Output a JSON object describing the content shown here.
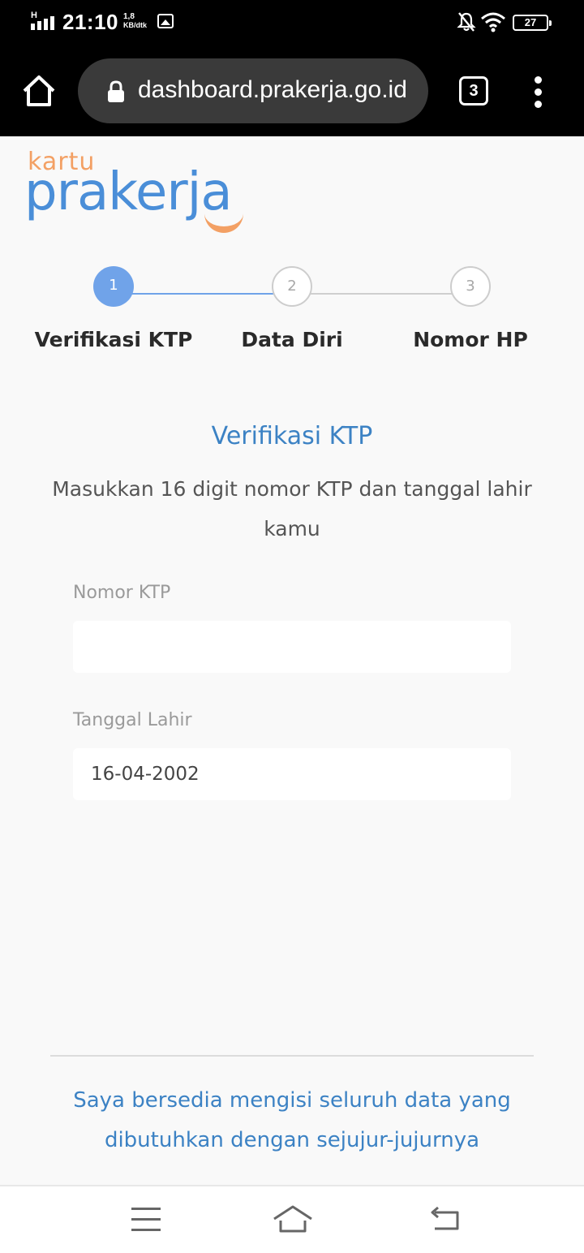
{
  "status_bar": {
    "network_type": "H",
    "time": "21:10",
    "speed_value": "1,8",
    "speed_unit": "KB/dtk",
    "battery": "27"
  },
  "browser": {
    "url": "dashboard.prakerja.go.id",
    "tab_count": "3"
  },
  "logo": {
    "kartu": "kartu",
    "prakerja": "prakerja"
  },
  "stepper": {
    "steps": [
      {
        "number": "1",
        "label": "Verifikasi KTP",
        "state": "active"
      },
      {
        "number": "2",
        "label": "Data Diri",
        "state": "inactive"
      },
      {
        "number": "3",
        "label": "Nomor HP",
        "state": "inactive"
      }
    ]
  },
  "form": {
    "title": "Verifikasi KTP",
    "description": "Masukkan 16 digit nomor KTP dan tanggal lahir kamu",
    "ktp_label": "Nomor KTP",
    "ktp_value": "",
    "dob_label": "Tanggal Lahir",
    "dob_value": "16-04-2002"
  },
  "consent_text": "Saya bersedia mengisi seluruh data yang dibutuhkan dengan sejujur-jujurnya",
  "colors": {
    "accent_blue": "#3c82c4",
    "step_active": "#70a3e9",
    "logo_blue": "#4a8ed8",
    "logo_orange": "#f3a064"
  },
  "icons": {
    "home": "home-icon",
    "lock": "lock-icon",
    "more": "more-vertical-icon",
    "nav_menu": "menu-icon",
    "nav_home": "home-outline-icon",
    "nav_back": "back-icon"
  }
}
